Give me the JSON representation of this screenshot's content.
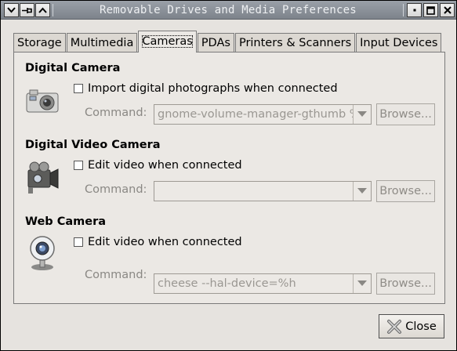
{
  "window": {
    "title": "Removable Drives and Media Preferences"
  },
  "tabs": [
    {
      "label": "Storage"
    },
    {
      "label": "Multimedia"
    },
    {
      "label": "Cameras"
    },
    {
      "label": "PDAs"
    },
    {
      "label": "Printers & Scanners"
    },
    {
      "label": "Input Devices"
    }
  ],
  "active_tab": "Cameras",
  "sections": {
    "digital_camera": {
      "title": "Digital Camera",
      "checkbox_label": "Import digital photographs when connected",
      "checkbox_checked": false,
      "command_label": "Command:",
      "command_value": "gnome-volume-manager-gthumb %h",
      "browse_label": "Browse..."
    },
    "digital_video_camera": {
      "title": "Digital Video Camera",
      "checkbox_label": "Edit video when connected",
      "checkbox_checked": false,
      "command_label": "Command:",
      "command_value": "",
      "browse_label": "Browse..."
    },
    "web_camera": {
      "title": "Web Camera",
      "checkbox_label": "Edit video when connected",
      "checkbox_checked": false,
      "command_label": "Command:",
      "command_value": "cheese --hal-device=%h",
      "browse_label": "Browse..."
    }
  },
  "footer": {
    "close_label": "Close"
  },
  "icons": {
    "digital_camera": "digital-camera-icon",
    "video_camera": "video-camera-icon",
    "web_camera": "webcam-icon",
    "close": "close-x-icon"
  }
}
